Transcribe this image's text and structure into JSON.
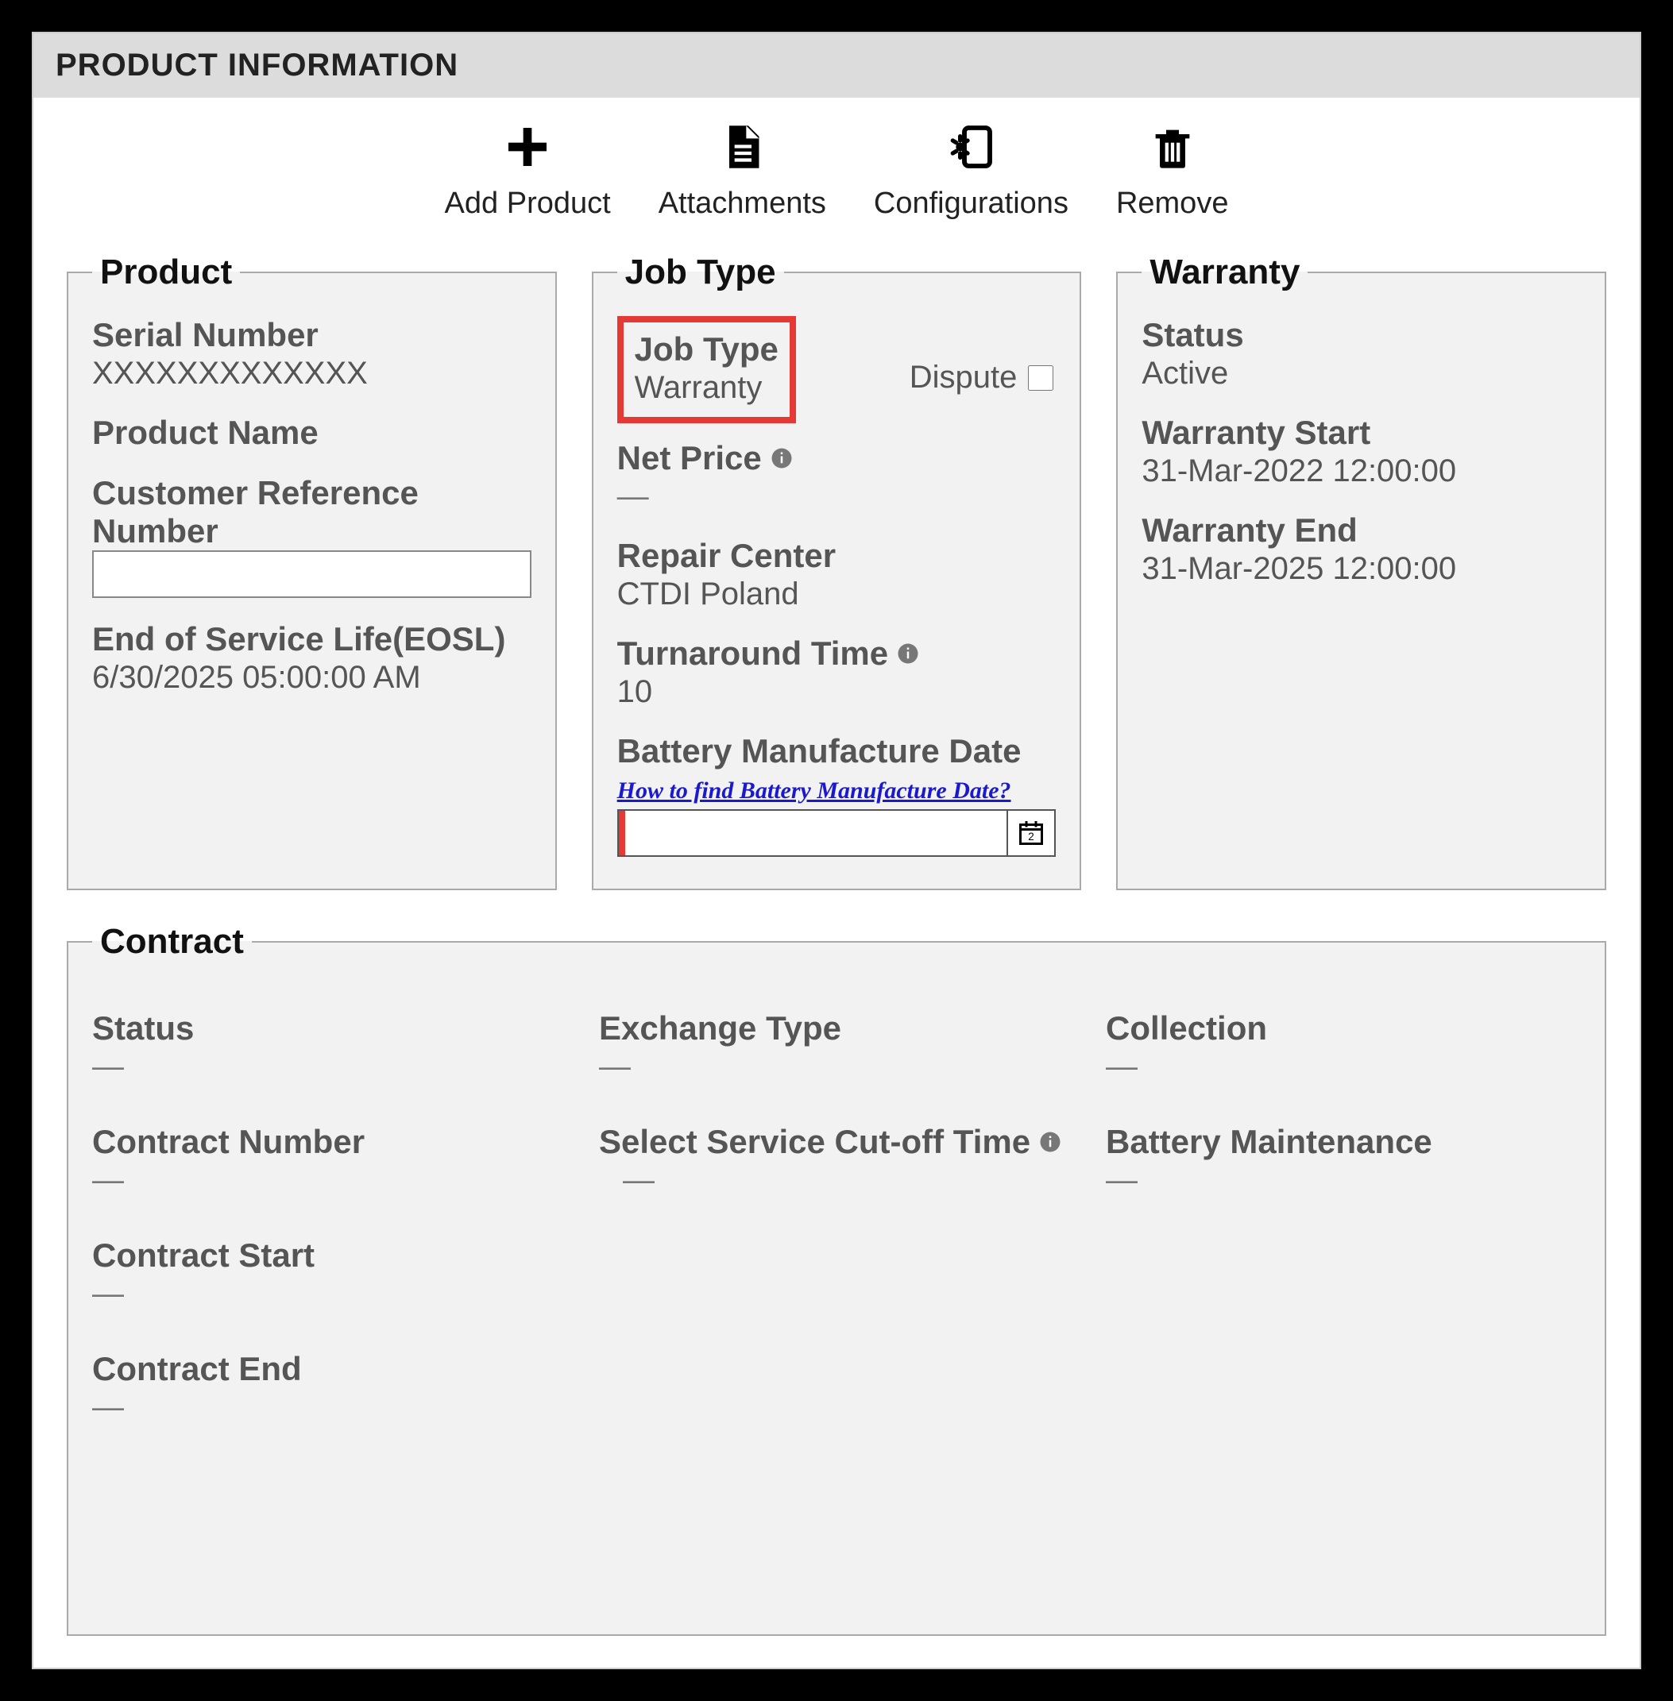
{
  "header": {
    "title": "PRODUCT INFORMATION"
  },
  "toolbar": {
    "addProduct": "Add Product",
    "attachments": "Attachments",
    "configurations": "Configurations",
    "remove": "Remove"
  },
  "product": {
    "legend": "Product",
    "serialNumber": {
      "label": "Serial Number",
      "value": "XXXXXXXXXXXXX"
    },
    "productName": {
      "label": "Product Name",
      "value": ""
    },
    "customerRef": {
      "label": "Customer Reference Number",
      "value": ""
    },
    "eosl": {
      "label": "End of Service Life(EOSL)",
      "value": "6/30/2025 05:00:00 AM"
    }
  },
  "jobType": {
    "legend": "Job Type",
    "jobType": {
      "label": "Job Type",
      "value": "Warranty"
    },
    "dispute": {
      "label": "Dispute",
      "checked": false
    },
    "netPrice": {
      "label": "Net Price",
      "value": "—"
    },
    "repairCenter": {
      "label": "Repair Center",
      "value": "CTDI Poland"
    },
    "turnaround": {
      "label": "Turnaround Time",
      "value": "10"
    },
    "batteryDate": {
      "label": "Battery Manufacture Date",
      "help": "How to find Battery Manufacture Date?",
      "value": ""
    }
  },
  "warranty": {
    "legend": "Warranty",
    "status": {
      "label": "Status",
      "value": "Active"
    },
    "start": {
      "label": "Warranty Start",
      "value": "31-Mar-2022 12:00:00"
    },
    "end": {
      "label": "Warranty End",
      "value": "31-Mar-2025 12:00:00"
    }
  },
  "contract": {
    "legend": "Contract",
    "status": {
      "label": "Status",
      "value": "—"
    },
    "exchangeType": {
      "label": "Exchange Type",
      "value": "—"
    },
    "collection": {
      "label": "Collection",
      "value": "—"
    },
    "contractNumber": {
      "label": "Contract Number",
      "value": "—"
    },
    "cutoff": {
      "label": "Select Service Cut-off Time",
      "value": "—"
    },
    "batteryMaint": {
      "label": "Battery Maintenance",
      "value": "—"
    },
    "contractStart": {
      "label": "Contract Start",
      "value": "—"
    },
    "contractEnd": {
      "label": "Contract End",
      "value": "—"
    }
  }
}
